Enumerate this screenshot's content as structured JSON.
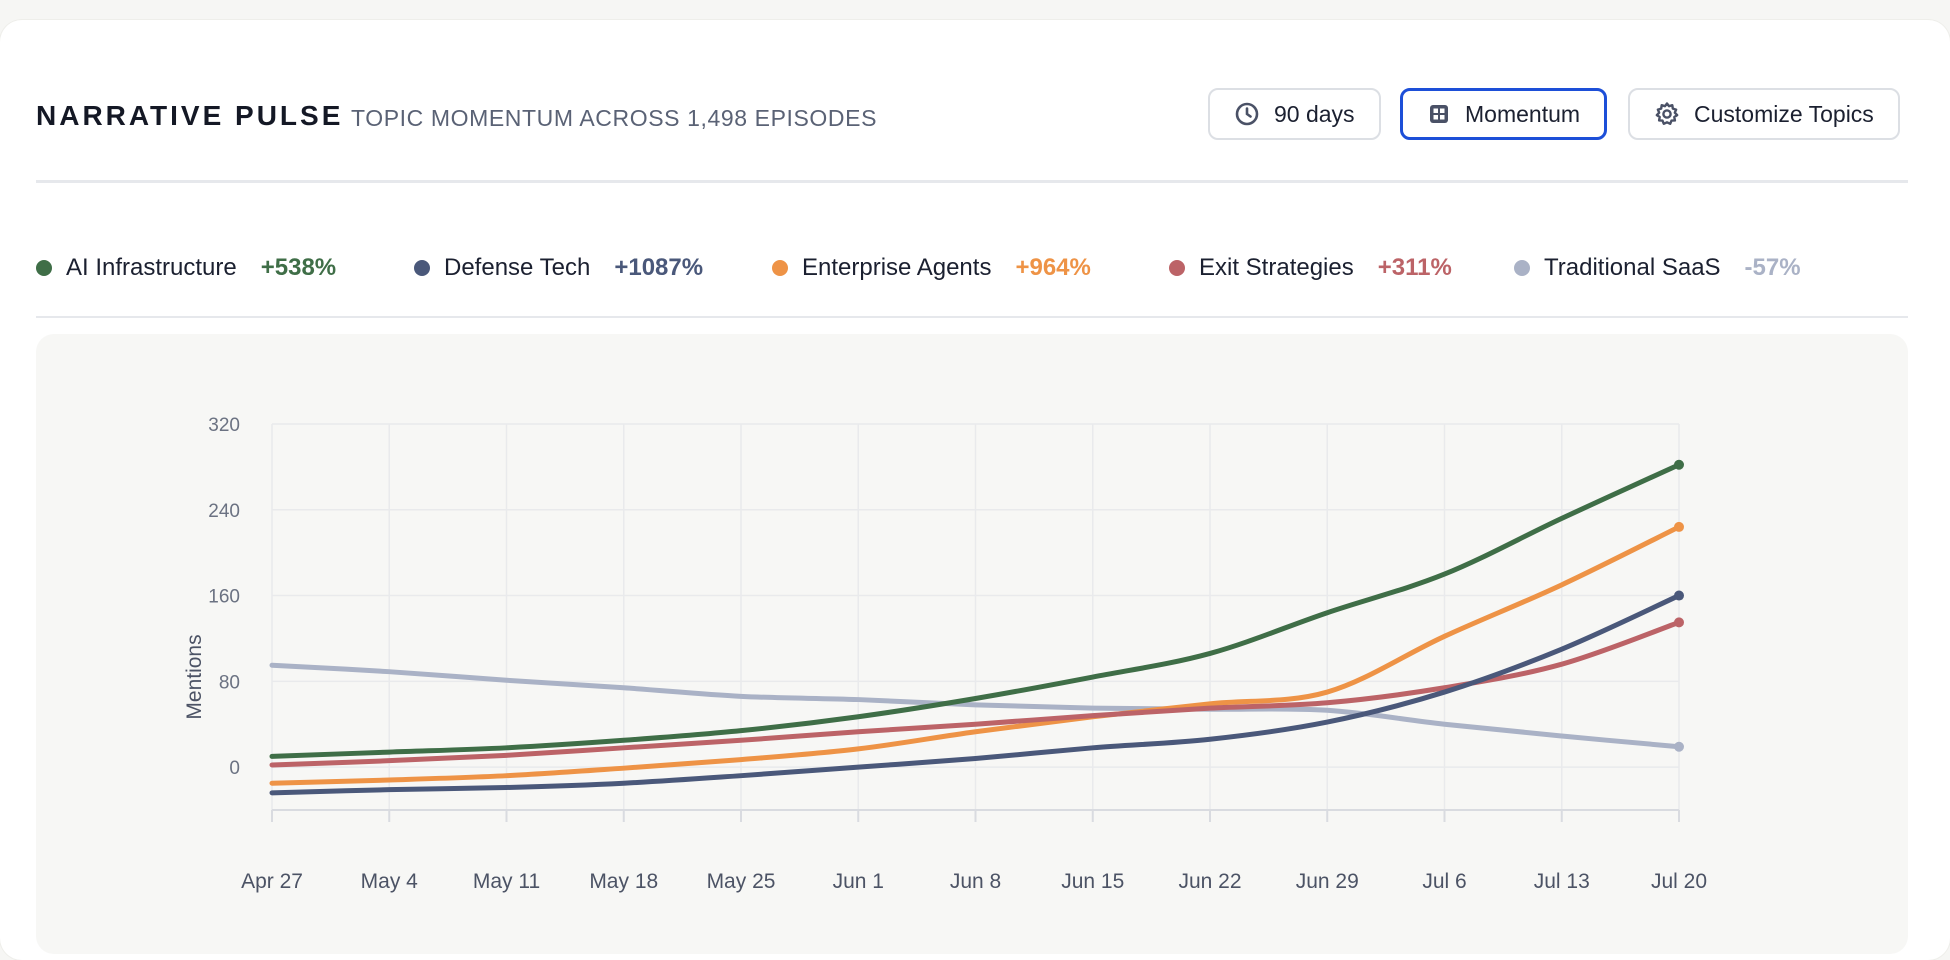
{
  "header": {
    "title": "NARRATIVE PULSE",
    "subtitle": "TOPIC MOMENTUM ACROSS 1,498 EPISODES",
    "buttons": [
      {
        "label": "90 days",
        "icon": "clock-icon"
      },
      {
        "label": "Momentum",
        "icon": "grid-icon",
        "active": true
      },
      {
        "label": "Customize Topics",
        "icon": "gear-icon"
      }
    ]
  },
  "colors": {
    "ai_infrastructure": "#3f6e47",
    "defense_tech": "#4a587a",
    "enterprise_agents": "#ee9346",
    "exit_strategies": "#bc6367",
    "traditional_saas": "#aab2c6",
    "active_border": "#1d4fd8"
  },
  "legend": [
    {
      "name": "AI Infrastructure",
      "change": "+538%",
      "color": "#3f6e47"
    },
    {
      "name": "Defense Tech",
      "change": "+1087%",
      "color": "#4a587a"
    },
    {
      "name": "Enterprise Agents",
      "change": "+964%",
      "color": "#ee9346"
    },
    {
      "name": "Exit Strategies",
      "change": "+311%",
      "color": "#bc6367"
    },
    {
      "name": "Traditional SaaS",
      "change": "-57%",
      "color": "#aab2c6"
    }
  ],
  "chart_data": {
    "type": "line",
    "title": "",
    "xlabel": "",
    "ylabel": "Mentions",
    "ylim": [
      -40,
      320
    ],
    "yticks": [
      0,
      80,
      160,
      240,
      320
    ],
    "grid": true,
    "legend_position": "top",
    "x": [
      "Apr 27",
      "May 4",
      "May 11",
      "May 18",
      "May 25",
      "Jun 1",
      "Jun 8",
      "Jun 15",
      "Jun 22",
      "Jun 29",
      "Jul 6",
      "Jul 13",
      "Jul 20"
    ],
    "series": [
      {
        "name": "AI Infrastructure",
        "color": "#3f6e47",
        "values": [
          10,
          14,
          18,
          25,
          34,
          47,
          64,
          84,
          106,
          144,
          180,
          232,
          282
        ]
      },
      {
        "name": "Defense Tech",
        "color": "#4a587a",
        "values": [
          -24,
          -21,
          -19,
          -15,
          -8,
          0,
          8,
          18,
          26,
          42,
          70,
          110,
          160
        ]
      },
      {
        "name": "Enterprise Agents",
        "color": "#ee9346",
        "values": [
          -15,
          -12,
          -8,
          -1,
          7,
          17,
          33,
          47,
          59,
          70,
          122,
          170,
          224
        ]
      },
      {
        "name": "Exit Strategies",
        "color": "#bc6367",
        "values": [
          2,
          6,
          11,
          18,
          25,
          33,
          40,
          48,
          55,
          60,
          74,
          96,
          135
        ]
      },
      {
        "name": "Traditional SaaS",
        "color": "#aab2c6",
        "values": [
          95,
          89,
          81,
          74,
          66,
          63,
          58,
          55,
          54,
          53,
          40,
          29,
          19
        ]
      }
    ]
  }
}
